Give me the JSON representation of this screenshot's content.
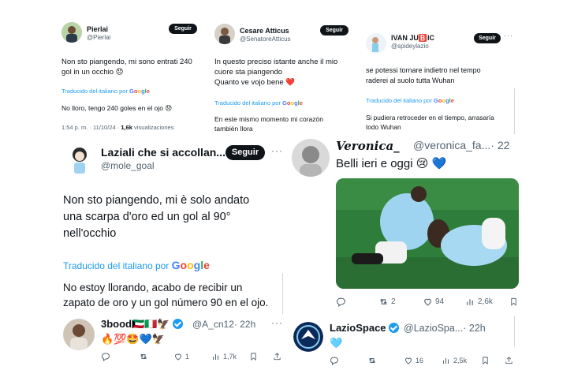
{
  "tweet1": {
    "name": "Pierlai",
    "handle": "@Pierlai",
    "follow": "Seguir",
    "text_line1": "Non sto piangendo, mi sono entrati 240",
    "text_line2": "gol in un occhio 😞",
    "translate_prefix": "Traducido del italiano por ",
    "google": "Google",
    "translation": "No lloro, tengo 240 goles en el ojo 😞",
    "date": "1:54 p. m. · 11/10/24 · ",
    "views_count": "1,6k",
    "views_label": " visualizaciones"
  },
  "tweet2": {
    "name": "Cesare Atticus",
    "handle": "@SenatoreAtticus",
    "follow": "Seguir",
    "text_line1": "In questo preciso istante anche il mio",
    "text_line2": "cuore sta piangendo",
    "text_line3": "Quanto ve vojo bene ❤️",
    "translate_prefix": "Traducido del italiano por ",
    "google": "Google",
    "translation_line1": "En este mismo momento mi corazón",
    "translation_line2": "también llora"
  },
  "tweet3": {
    "name": "IVAN JU🅱️IC",
    "handle": "@spideylazio",
    "follow": "Seguir",
    "text_line1": "se potessi tornare indietro nel tempo",
    "text_line2": "raderei al suolo tutta Wuhan",
    "translate_prefix": "Traducido del italiano por ",
    "google": "Google",
    "translation_line1": "Si pudiera retroceder en el tiempo, arrasaría",
    "translation_line2": "todo Wuhan"
  },
  "tweet4": {
    "name": "Laziali che si accollan...",
    "handle": "@mole_goal",
    "follow": "Seguir",
    "text_line1": "Non sto piangendo, mi è solo andato",
    "text_line2": "una scarpa d'oro ed un gol al 90°",
    "text_line3": "nell'occhio",
    "translate_prefix": "Traducido del italiano por ",
    "google": "Google",
    "translation_line1": "No estoy llorando, acabo de recibir un",
    "translation_line2": "zapato de oro y un gol número 90 en el ojo."
  },
  "tweet5": {
    "name": "Veronica_",
    "handle": "@veronica_fa...",
    "time": "· 22",
    "text": "Belli ieri e oggi 😢 💙",
    "replies": "",
    "retweets": "2",
    "likes": "94",
    "views": "2,6k"
  },
  "reply1": {
    "name": "3bood🇰🇼🇮🇹🦅",
    "handle": "@A_cn12",
    "time": "· 22h",
    "text": "🔥💯🤩💙🦅",
    "replies": "",
    "retweets": "",
    "likes": "1",
    "views": "1,7k"
  },
  "reply2": {
    "name": "LazioSpace",
    "handle": "@LazioSpa...",
    "time": "· 22h",
    "text": "🩵",
    "replies": "",
    "retweets": "",
    "likes": "16",
    "views": "2,5k"
  },
  "icons": {
    "reply": "reply-icon",
    "retweet": "retweet-icon",
    "like": "heart-icon",
    "views": "views-icon",
    "bookmark": "bookmark-icon",
    "share": "share-icon"
  },
  "colors": {
    "link": "#1d9bf0",
    "muted": "#536471",
    "lazio_sky": "#87ceeb"
  }
}
